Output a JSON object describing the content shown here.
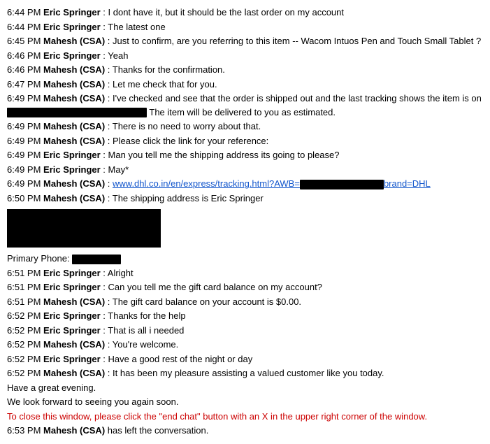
{
  "chat": {
    "lines": [
      {
        "time": "6:44 PM",
        "speaker": "Eric Springer",
        "text": "I dont have it, but it should be the last order on my account"
      },
      {
        "time": "6:44 PM",
        "speaker": "Eric Springer",
        "text": "The latest one"
      },
      {
        "time": "6:45 PM",
        "speaker": "Mahesh (CSA)",
        "text": "Just to confirm, are you referring to this item -- Wacom Intuos Pen and Touch Small Tablet ?"
      },
      {
        "time": "6:46 PM",
        "speaker": "Eric Springer",
        "text": "Yeah"
      },
      {
        "time": "6:46 PM",
        "speaker": "Mahesh (CSA)",
        "text": "Thanks for the confirmation."
      },
      {
        "time": "6:47 PM",
        "speaker": "Mahesh (CSA)",
        "text": "Let me check that for you."
      },
      {
        "time": "6:49 PM",
        "speaker": "Mahesh (CSA)",
        "text_parts": [
          "I've checked and see that the order is shipped out and the last tracking shows the item is on",
          "REDACTED_WIDE",
          " The item will be delivered to you as estimated."
        ]
      },
      {
        "time": "6:49 PM",
        "speaker": "Mahesh (CSA)",
        "text": "There is no need to worry about that."
      },
      {
        "time": "6:49 PM",
        "speaker": "Mahesh (CSA)",
        "text": "Please click the link for your reference:"
      },
      {
        "time": "6:49 PM",
        "speaker": "Eric Springer",
        "text": "Man you tell me the shipping address its going to please?"
      },
      {
        "time": "6:49 PM",
        "speaker": "Eric Springer",
        "text": "May*"
      },
      {
        "time": "6:49 PM",
        "speaker": "Mahesh (CSA)",
        "link_parts": [
          "www.dhl.co.in/en/express/tracking.html?AWB=",
          "REDACTED_MEDIUM",
          "brand=DHL"
        ]
      },
      {
        "time": "6:50 PM",
        "speaker": "Mahesh (CSA)",
        "text": "The shipping address is Eric Springer"
      },
      {
        "type": "redacted_block"
      },
      {
        "type": "primary_phone"
      },
      {
        "time": "6:51 PM",
        "speaker": "Eric Springer",
        "text": "Alright"
      },
      {
        "time": "6:51 PM",
        "speaker": "Eric Springer",
        "text": "Can you tell me the gift card balance on my account?"
      },
      {
        "time": "6:51 PM",
        "speaker": "Mahesh (CSA)",
        "text": "The gift card balance on your account is $0.00."
      },
      {
        "time": "6:52 PM",
        "speaker": "Eric Springer",
        "text": "Thanks for the help"
      },
      {
        "time": "6:52 PM",
        "speaker": "Eric Springer",
        "text": "That is all i needed"
      },
      {
        "time": "6:52 PM",
        "speaker": "Mahesh (CSA)",
        "text": "You're welcome."
      },
      {
        "time": "6:52 PM",
        "speaker": "Eric Springer",
        "text": "Have a good rest of the night or day"
      },
      {
        "time": "6:52 PM",
        "speaker": "Mahesh (CSA)",
        "text": "It has been my pleasure assisting a valued customer like you today."
      },
      {
        "type": "plain",
        "text": "Have a great evening."
      },
      {
        "type": "plain",
        "text": "We look forward to seeing you again soon."
      },
      {
        "type": "closing_note",
        "text": "To close this window, please click the \"end chat\" button with an X in the upper right corner of the window."
      },
      {
        "time": "6:53 PM",
        "speaker": "Mahesh (CSA)",
        "text": "has left the conversation."
      }
    ]
  },
  "labels": {
    "primary_phone": "Primary Phone:"
  }
}
